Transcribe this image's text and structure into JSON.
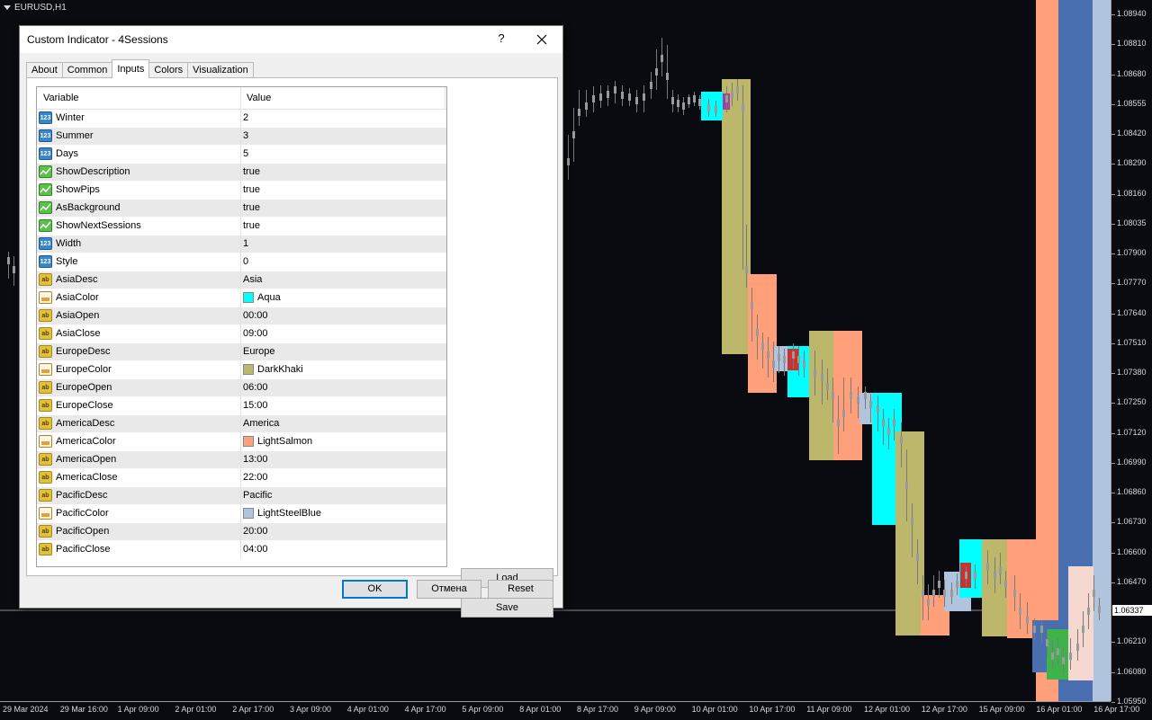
{
  "chart": {
    "symbol": "EURUSD,H1",
    "current_price": "1.06337",
    "price_ticks": [
      "1.08940",
      "1.08810",
      "1.08680",
      "1.08555",
      "1.08420",
      "1.08290",
      "1.08160",
      "1.08035",
      "1.07900",
      "1.07770",
      "1.07640",
      "1.07510",
      "1.07380",
      "1.07250",
      "1.07120",
      "1.06990",
      "1.06860",
      "1.06730",
      "1.06600",
      "1.06470",
      "1.06337",
      "1.06210",
      "1.06080",
      "1.05950"
    ],
    "time_ticks": [
      "29 Mar 2024",
      "29 Mar 16:00",
      "1 Apr 09:00",
      "2 Apr 01:00",
      "2 Apr 17:00",
      "3 Apr 09:00",
      "4 Apr 01:00",
      "4 Apr 17:00",
      "5 Apr 09:00",
      "8 Apr 01:00",
      "8 Apr 17:00",
      "9 Apr 09:00",
      "10 Apr 01:00",
      "10 Apr 17:00",
      "11 Apr 09:00",
      "12 Apr 01:00",
      "12 Apr 17:00",
      "15 Apr 09:00",
      "16 Apr 01:00",
      "16 Apr 17:00"
    ],
    "session_colors": {
      "asia": "#00FFFF",
      "europe": "#BDB76B",
      "america": "#FFA07A",
      "pacific": "#B0C4DE",
      "overlap_magenta": "#A040A0",
      "overlap_red": "#C83232",
      "overlap_green": "#3CB44B",
      "overlap_blue": "#4A6FB0",
      "overlap_pink": "#F5D8D0"
    }
  },
  "dialog": {
    "title": "Custom Indicator - 4Sessions",
    "help_label": "?",
    "tabs": [
      "About",
      "Common",
      "Inputs",
      "Colors",
      "Visualization"
    ],
    "active_tab": "Inputs",
    "grid": {
      "header_variable": "Variable",
      "header_value": "Value",
      "rows": [
        {
          "icon": "number-icon",
          "type": "num",
          "name": "Winter",
          "value": "2"
        },
        {
          "icon": "number-icon",
          "type": "num",
          "name": "Summer",
          "value": "3"
        },
        {
          "icon": "number-icon",
          "type": "num",
          "name": "Days",
          "value": "5"
        },
        {
          "icon": "boolean-icon",
          "type": "bool",
          "name": "ShowDescription",
          "value": "true"
        },
        {
          "icon": "boolean-icon",
          "type": "bool",
          "name": "ShowPips",
          "value": "true"
        },
        {
          "icon": "boolean-icon",
          "type": "bool",
          "name": "AsBackground",
          "value": "true"
        },
        {
          "icon": "boolean-icon",
          "type": "bool",
          "name": "ShowNextSessions",
          "value": "true"
        },
        {
          "icon": "number-icon",
          "type": "num",
          "name": "Width",
          "value": "1"
        },
        {
          "icon": "number-icon",
          "type": "num",
          "name": "Style",
          "value": "0"
        },
        {
          "icon": "string-icon",
          "type": "str",
          "name": "AsiaDesc",
          "value": "Asia"
        },
        {
          "icon": "color-icon",
          "type": "col",
          "name": "AsiaColor",
          "value": "Aqua",
          "swatch": "#00FFFF"
        },
        {
          "icon": "string-icon",
          "type": "str",
          "name": "AsiaOpen",
          "value": "00:00"
        },
        {
          "icon": "string-icon",
          "type": "str",
          "name": "AsiaClose",
          "value": "09:00"
        },
        {
          "icon": "string-icon",
          "type": "str",
          "name": "EuropeDesc",
          "value": "Europe"
        },
        {
          "icon": "color-icon",
          "type": "col",
          "name": "EuropeColor",
          "value": "DarkKhaki",
          "swatch": "#BDB76B"
        },
        {
          "icon": "string-icon",
          "type": "str",
          "name": "EuropeOpen",
          "value": "06:00"
        },
        {
          "icon": "string-icon",
          "type": "str",
          "name": "EuropeClose",
          "value": "15:00"
        },
        {
          "icon": "string-icon",
          "type": "str",
          "name": "AmericaDesc",
          "value": "America"
        },
        {
          "icon": "color-icon",
          "type": "col",
          "name": "AmericaColor",
          "value": "LightSalmon",
          "swatch": "#FFA07A"
        },
        {
          "icon": "string-icon",
          "type": "str",
          "name": "AmericaOpen",
          "value": "13:00"
        },
        {
          "icon": "string-icon",
          "type": "str",
          "name": "AmericaClose",
          "value": "22:00"
        },
        {
          "icon": "string-icon",
          "type": "str",
          "name": "PacificDesc",
          "value": "Pacific"
        },
        {
          "icon": "color-icon",
          "type": "col",
          "name": "PacificColor",
          "value": "LightSteelBlue",
          "swatch": "#B0C4DE"
        },
        {
          "icon": "string-icon",
          "type": "str",
          "name": "PacificOpen",
          "value": "20:00"
        },
        {
          "icon": "string-icon",
          "type": "str",
          "name": "PacificClose",
          "value": "04:00"
        }
      ]
    },
    "buttons": {
      "load": "Load",
      "save": "Save",
      "ok": "OK",
      "cancel": "Отмена",
      "reset": "Reset"
    }
  }
}
